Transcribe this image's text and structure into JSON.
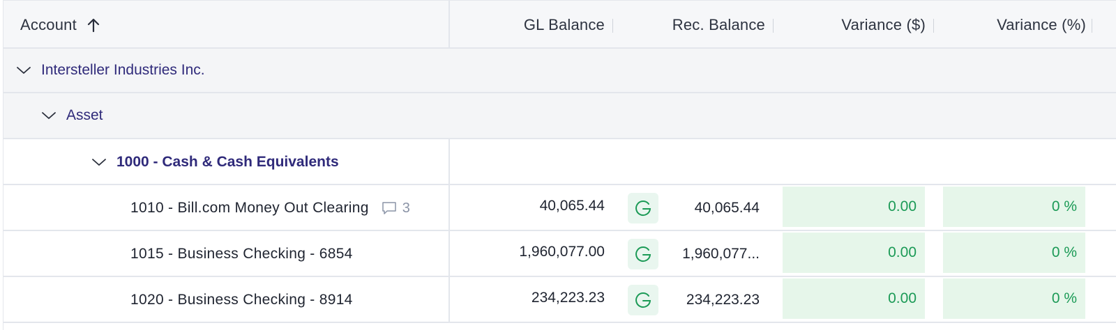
{
  "header": {
    "account": "Account",
    "gl_balance": "GL Balance",
    "rec_balance": "Rec. Balance",
    "variance_dollar": "Variance ($)",
    "variance_pct": "Variance (%)"
  },
  "groups": {
    "entity": "Intersteller Industries Inc.",
    "type": "Asset",
    "parent": "1000 - Cash & Cash Equivalents"
  },
  "rows": [
    {
      "name": "1010 - Bill.com Money Out Clearing",
      "comments": "3",
      "gl": "40,065.44",
      "rec": "40,065.44",
      "var_d": "0.00",
      "var_p": "0 %"
    },
    {
      "name": "1015 - Business Checking - 6854",
      "gl": "1,960,077.00",
      "rec": "1,960,077...",
      "var_d": "0.00",
      "var_p": "0 %"
    },
    {
      "name": "1020 - Business Checking - 8914",
      "gl": "234,223.23",
      "rec": "234,223.23",
      "var_d": "0.00",
      "var_p": "0 %"
    }
  ],
  "colors": {
    "accent": "#2f2a7a",
    "success": "#1b9a56",
    "success_bg": "#e6f6ea"
  },
  "icons": {
    "sort": "arrow-up-icon",
    "expand": "chevron-down-icon",
    "comment": "comment-icon",
    "rec_source": "g-badge-icon"
  }
}
